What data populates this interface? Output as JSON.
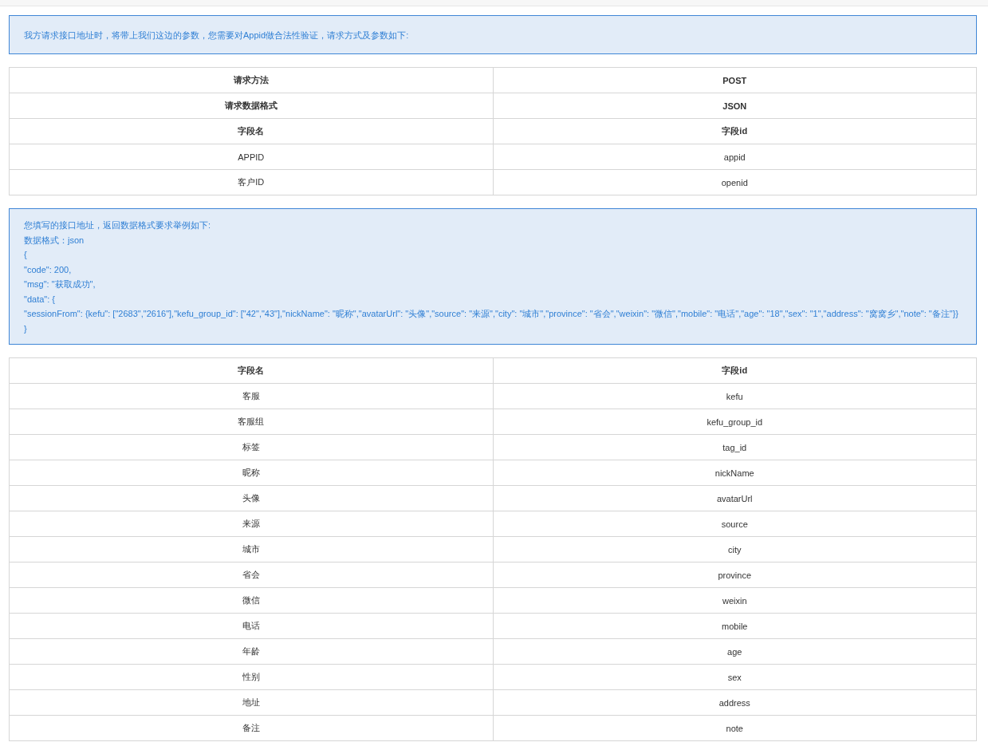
{
  "notice": {
    "text": "我方请求接口地址时，将带上我们这边的参数，您需要对Appid做合法性验证，请求方式及参数如下:"
  },
  "request_table": {
    "rows": [
      {
        "kind": "header",
        "cells": [
          "请求方法",
          "POST"
        ]
      },
      {
        "kind": "header",
        "cells": [
          "请求数据格式",
          "JSON"
        ]
      },
      {
        "kind": "header",
        "cells": [
          "字段名",
          "字段id"
        ]
      },
      {
        "kind": "row",
        "cells": [
          "APPID",
          "appid"
        ]
      },
      {
        "kind": "row",
        "cells": [
          "客户ID",
          "openid"
        ]
      }
    ]
  },
  "response_example": {
    "lines": [
      "您填写的接口地址，返回数据格式要求举例如下:",
      "数据格式：json",
      "{",
      "\"code\": 200,",
      "\"msg\": \"获取成功\",",
      "\"data\": {",
      "\"sessionFrom\": {kefu\": [\"2683\",\"2616\"],\"kefu_group_id\": [\"42\",\"43\"],\"nickName\": \"昵称\",\"avatarUrl\": \"头像\",\"source\": \"来源\",\"city\": \"城市\",\"province\": \"省会\",\"weixin\": \"微信\",\"mobile\": \"电话\",\"age\": \"18\",\"sex\": \"1\",\"address\": \"窝窝乡\",\"note\": \"备注\"}}",
      "}"
    ]
  },
  "fields_table": {
    "rows": [
      {
        "kind": "header",
        "cells": [
          "字段名",
          "字段id"
        ]
      },
      {
        "kind": "row",
        "cells": [
          "客服",
          "kefu"
        ]
      },
      {
        "kind": "row",
        "cells": [
          "客服组",
          "kefu_group_id"
        ]
      },
      {
        "kind": "row",
        "cells": [
          "标签",
          "tag_id"
        ]
      },
      {
        "kind": "row",
        "cells": [
          "昵称",
          "nickName"
        ]
      },
      {
        "kind": "row",
        "cells": [
          "头像",
          "avatarUrl"
        ]
      },
      {
        "kind": "row",
        "cells": [
          "来源",
          "source"
        ]
      },
      {
        "kind": "row",
        "cells": [
          "城市",
          "city"
        ]
      },
      {
        "kind": "row",
        "cells": [
          "省会",
          "province"
        ]
      },
      {
        "kind": "row",
        "cells": [
          "微信",
          "weixin"
        ]
      },
      {
        "kind": "row",
        "cells": [
          "电话",
          "mobile"
        ]
      },
      {
        "kind": "row",
        "cells": [
          "年龄",
          "age"
        ]
      },
      {
        "kind": "row",
        "cells": [
          "性别",
          "sex"
        ]
      },
      {
        "kind": "row",
        "cells": [
          "地址",
          "address"
        ]
      },
      {
        "kind": "row",
        "cells": [
          "备注",
          "note"
        ]
      }
    ]
  }
}
